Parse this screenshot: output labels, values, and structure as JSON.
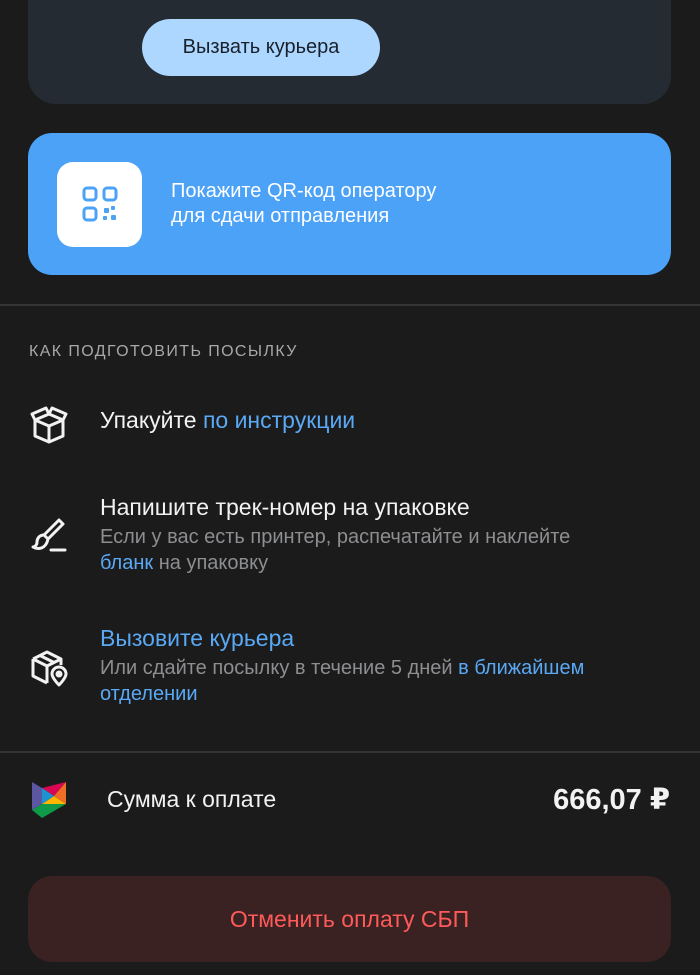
{
  "courier_card": {
    "button_label": "Вызвать курьера"
  },
  "qr_card": {
    "line1": "Покажите QR-код оператору",
    "line2": "для сдачи отправления",
    "icon": "qr-code-icon"
  },
  "prepare": {
    "title": "КАК ПОДГОТОВИТЬ ПОСЫЛКУ",
    "steps": [
      {
        "icon": "box-icon",
        "title_prefix": "Упакуйте ",
        "title_link": "по инструкции"
      },
      {
        "icon": "brush-icon",
        "title": "Напишите трек-номер на упаковке",
        "sub_prefix": "Если у вас есть принтер, распечатайте и наклейте",
        "sub_link": "бланк",
        "sub_suffix": " на упаковку"
      },
      {
        "icon": "box-location-icon",
        "title_link": "Вызовите курьера",
        "sub_prefix": "Или сдайте посылку в течение 5 дней ",
        "sub_link": "в ближайшем отделении"
      }
    ]
  },
  "payment": {
    "icon": "sbp-logo-icon",
    "label": "Сумма к оплате",
    "amount": "666,07 ₽"
  },
  "cancel_button": {
    "label": "Отменить оплату СБП"
  },
  "colors": {
    "background": "#1b1b1c",
    "accent_blue": "#4ba2f7",
    "link_blue": "#5aa9f5",
    "courier_button": "#aed7ff",
    "cancel_bg": "#3b2222",
    "cancel_text": "#ff5a5a"
  }
}
